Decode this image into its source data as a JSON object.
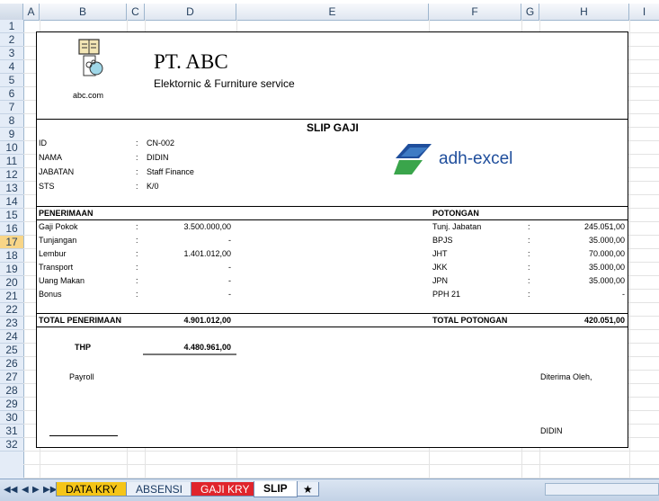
{
  "columns": [
    "A",
    "B",
    "C",
    "D",
    "E",
    "F",
    "G",
    "H",
    "I"
  ],
  "rows": [
    "1",
    "2",
    "3",
    "4",
    "5",
    "6",
    "7",
    "8",
    "9",
    "10",
    "11",
    "12",
    "13",
    "14",
    "15",
    "16",
    "17",
    "18",
    "19",
    "20",
    "21",
    "22",
    "23",
    "24",
    "25",
    "26",
    "27",
    "28",
    "29",
    "30",
    "31",
    "32"
  ],
  "selected_row": "17",
  "company": {
    "name": "PT. ABC",
    "tagline": "Elektornic & Furniture  service",
    "site": "abc.com"
  },
  "slip_title": "SLIP GAJI",
  "watermark": "adh-excel",
  "employee": [
    {
      "label": "ID",
      "value": "CN-002"
    },
    {
      "label": "NAMA",
      "value": "DIDIN"
    },
    {
      "label": "JABATAN",
      "value": "Staff Finance"
    },
    {
      "label": "STS",
      "value": "K/0"
    }
  ],
  "colon": ":",
  "penerimaan": {
    "header": "PENERIMAAN",
    "items": [
      {
        "label": "Gaji Pokok",
        "value": "3.500.000,00"
      },
      {
        "label": "Tunjangan",
        "value": "-"
      },
      {
        "label": "Lembur",
        "value": "1.401.012,00"
      },
      {
        "label": "Transport",
        "value": "-"
      },
      {
        "label": "Uang Makan",
        "value": "-"
      },
      {
        "label": "Bonus",
        "value": "-"
      }
    ],
    "total_label": "TOTAL PENERIMAAN",
    "total_value": "4.901.012,00"
  },
  "potongan": {
    "header": "POTONGAN",
    "items": [
      {
        "label": "Tunj. Jabatan",
        "value": "245.051,00"
      },
      {
        "label": "BPJS",
        "value": "35.000,00"
      },
      {
        "label": "JHT",
        "value": "70.000,00"
      },
      {
        "label": "JKK",
        "value": "35.000,00"
      },
      {
        "label": "JPN",
        "value": "35.000,00"
      },
      {
        "label": "PPH 21",
        "value": "-"
      }
    ],
    "total_label": "TOTAL POTONGAN",
    "total_value": "420.051,00"
  },
  "thp": {
    "label": "THP",
    "value": "4.480.961,00"
  },
  "signature": {
    "left_label": "Payroll",
    "right_label": "Diterima Oleh,",
    "right_name": "DIDIN"
  },
  "sheet_tabs": [
    {
      "label": "DATA KRY",
      "color": "#f5c518"
    },
    {
      "label": "ABSENSI",
      "color": "#ffffff"
    },
    {
      "label": "GAJI KRY",
      "color": "#e0242b"
    },
    {
      "label": "SLIP",
      "color": "#ffffff",
      "active": true
    }
  ],
  "colors": {
    "accent_blue": "#1f4e9c",
    "accent_green": "#3aa54b"
  }
}
